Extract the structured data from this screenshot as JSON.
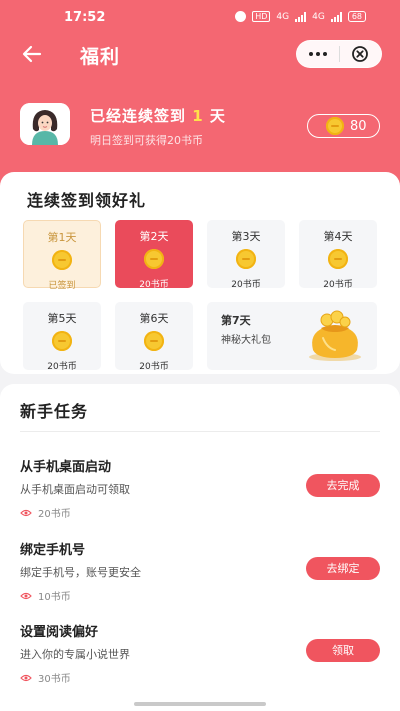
{
  "status_bar": {
    "time": "17:52",
    "hd_label": "HD",
    "signal_1_label": "4G",
    "signal_2_label": "4G",
    "battery": "68"
  },
  "nav": {
    "title": "福利",
    "back_icon": "arrow-left-icon",
    "more_icon": "more-dots-icon",
    "close_icon": "close-circle-icon"
  },
  "user": {
    "checkin_prefix": "已经连续签到",
    "checkin_days": "1",
    "checkin_suffix": "天",
    "subtitle": "明日签到可获得20书币",
    "coins": "80"
  },
  "signin": {
    "title": "连续签到领好礼",
    "days": [
      {
        "label": "第1天",
        "reward": "已签到",
        "state": "done"
      },
      {
        "label": "第2天",
        "reward": "20书币",
        "state": "today"
      },
      {
        "label": "第3天",
        "reward": "20书币",
        "state": "pending"
      },
      {
        "label": "第4天",
        "reward": "20书币",
        "state": "pending"
      },
      {
        "label": "第5天",
        "reward": "20书币",
        "state": "pending"
      },
      {
        "label": "第6天",
        "reward": "20书币",
        "state": "pending"
      }
    ],
    "day7": {
      "label": "第7天",
      "reward": "神秘大礼包"
    }
  },
  "tasks": {
    "title": "新手任务",
    "items": [
      {
        "title": "从手机桌面启动",
        "desc": "从手机桌面启动可领取",
        "reward": "20书币",
        "button": "去完成"
      },
      {
        "title": "绑定手机号",
        "desc": "绑定手机号，账号更安全",
        "reward": "10书币",
        "button": "去绑定"
      },
      {
        "title": "设置阅读偏好",
        "desc": "进入你的专属小说世界",
        "reward": "30书币",
        "button": "领取"
      }
    ]
  },
  "colors": {
    "brand": "#f46772",
    "accent_button": "#f0555f",
    "today_tile": "#ea4b5b",
    "coin": "#f7c831",
    "highlight": "#ffe14a"
  }
}
